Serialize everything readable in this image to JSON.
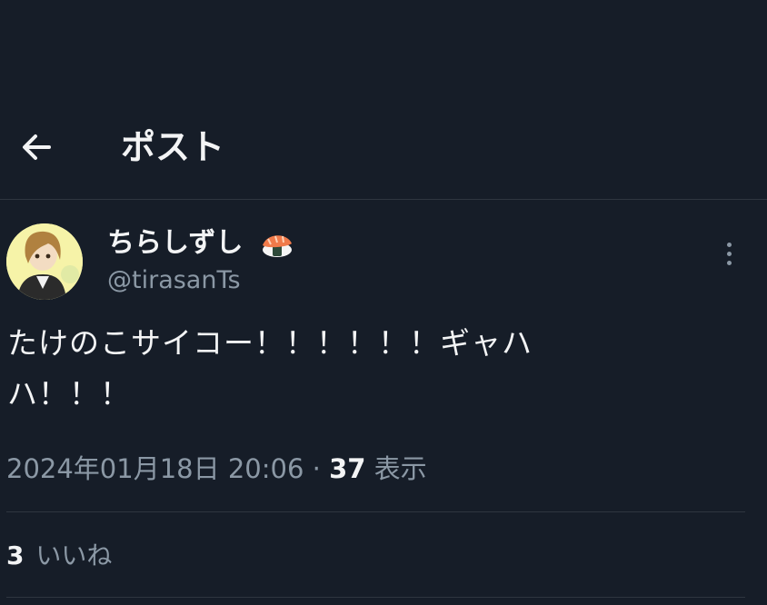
{
  "header": {
    "back_icon": "arrow-left-icon",
    "title": "ポスト"
  },
  "post": {
    "author": {
      "display_name": "ちらしずし",
      "name_emoji": "sushi-icon",
      "handle": "@tirasanTs"
    },
    "text_line1": "たけのこサイコー！！！！！！ギャハ",
    "text_line2": "ハ！！！",
    "timestamp": "2024年01月18日 20:06",
    "separator": "·",
    "views_count": "37",
    "views_label": "表示",
    "likes_count": "3",
    "likes_label": "いいね"
  },
  "colors": {
    "background": "#161d28",
    "text": "#e7e9ea",
    "secondary": "#8b98a5",
    "divider": "#2f3640"
  }
}
